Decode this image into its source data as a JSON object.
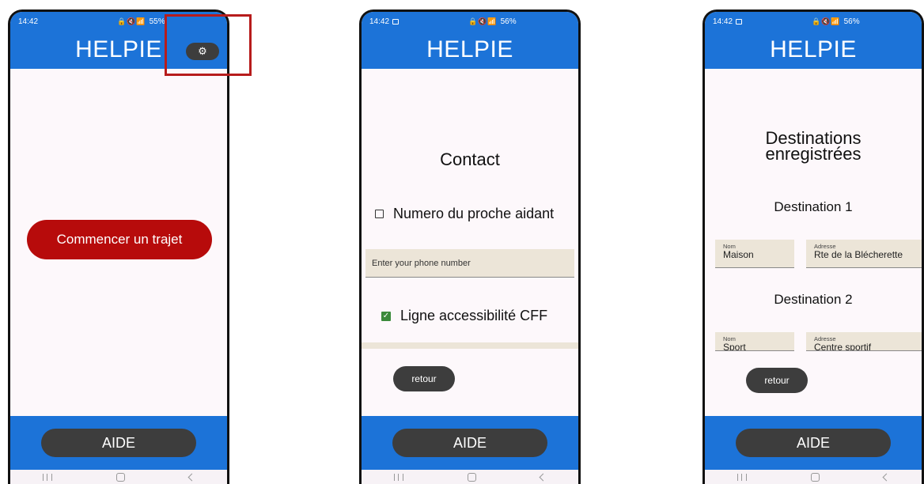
{
  "status_bar": {
    "time": "14:42",
    "phone1_battery": "55%",
    "phone2_battery": "56%",
    "phone3_battery": "56%"
  },
  "app": {
    "title": "HELPIE",
    "aide_label": "AIDE",
    "settings_icon": "gear-icon"
  },
  "phone1": {
    "start_label": "Commencer un trajet"
  },
  "phone2": {
    "title": "Contact",
    "checkbox1": {
      "label": "Numero du proche aidant",
      "checked": false
    },
    "phone_placeholder": "Enter your phone number",
    "checkbox2": {
      "label": "Ligne accessibilité CFF",
      "checked": true
    },
    "back_label": "retour"
  },
  "phone3": {
    "title_line1": "Destinations",
    "title_line2": "enregistrées",
    "destinations": [
      {
        "heading": "Destination 1",
        "name_label": "Nom",
        "name_value": "Maison",
        "address_label": "Adresse",
        "address_value": "Rte de la Blécherette"
      },
      {
        "heading": "Destination 2",
        "name_label": "Nom",
        "name_value": "Sport",
        "address_label": "Adresse",
        "address_value": "Centre sportif"
      }
    ],
    "back_label": "retour"
  },
  "colors": {
    "primary_blue": "#1c73d8",
    "start_red": "#b70b0b",
    "dark_button": "#3d3d3d",
    "highlight_red": "#b71c1c",
    "field_beige": "#ece5d8"
  }
}
